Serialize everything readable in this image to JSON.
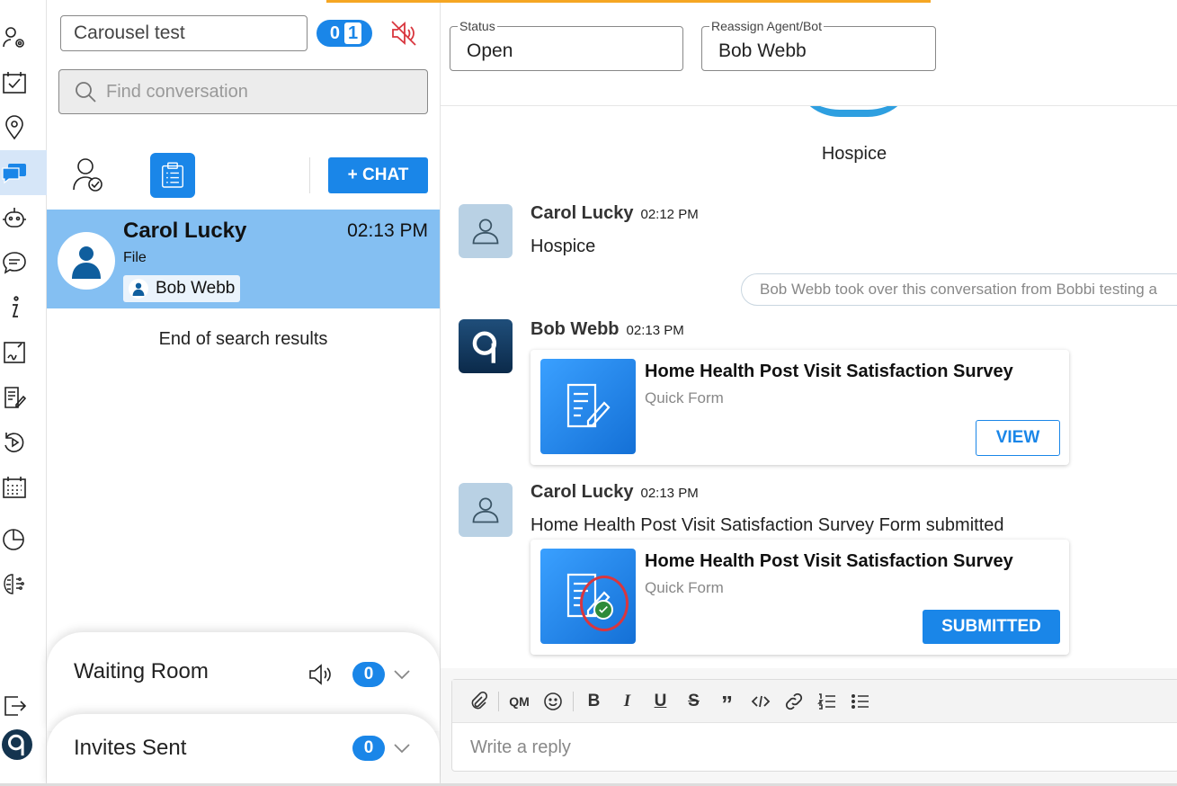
{
  "sidebar": {
    "items": [
      {
        "icon": "user-settings-icon"
      },
      {
        "icon": "calendar-check-icon"
      },
      {
        "icon": "location-pin-icon"
      },
      {
        "icon": "chat-icon",
        "active": true
      },
      {
        "icon": "bot-icon"
      },
      {
        "icon": "message-bubble-icon"
      },
      {
        "icon": "info-icon"
      },
      {
        "icon": "form-signature-icon"
      },
      {
        "icon": "document-edit-icon"
      },
      {
        "icon": "history-play-icon"
      },
      {
        "icon": "calendar-grid-icon"
      },
      {
        "icon": "pie-chart-icon"
      },
      {
        "icon": "brain-icon"
      },
      {
        "icon": "logout-icon"
      },
      {
        "icon": "app-logo-icon"
      }
    ]
  },
  "list": {
    "conversation_name": "Carousel test",
    "toggle": {
      "left": "0",
      "right": "1"
    },
    "search_placeholder": "Find conversation",
    "chat_button": "+ CHAT",
    "conversation": {
      "name": "Carol Lucky",
      "time": "02:13 PM",
      "subtitle": "File",
      "agent": "Bob Webb"
    },
    "end_text": "End of search results",
    "waiting_room": {
      "title": "Waiting Room",
      "count": "0"
    },
    "invites_sent": {
      "title": "Invites Sent",
      "count": "0"
    }
  },
  "header": {
    "status_label": "Status",
    "status_value": "Open",
    "agent_label": "Reassign Agent/Bot",
    "agent_value": "Bob Webb"
  },
  "messages": {
    "prev_label": "Hospice",
    "m1": {
      "name": "Carol Lucky",
      "time": "02:12 PM",
      "text": "Hospice"
    },
    "system": "Bob Webb took over this conversation from Bobbi testing a",
    "m2": {
      "name": "Bob Webb",
      "time": "02:13 PM",
      "card": {
        "title": "Home Health Post Visit Satisfaction Survey",
        "sub": "Quick Form",
        "button": "VIEW"
      }
    },
    "m3": {
      "name": "Carol Lucky",
      "time": "02:13 PM",
      "text": "Home Health Post Visit Satisfaction Survey Form submitted",
      "card": {
        "title": "Home Health Post Visit Satisfaction Survey",
        "sub": "Quick Form",
        "button": "SUBMITTED"
      }
    }
  },
  "composer": {
    "toolbar": {
      "qm": "QM",
      "bold": "B",
      "italic": "I",
      "underline": "U",
      "strike": "S",
      "quote": "”"
    },
    "placeholder": "Write a reply"
  },
  "colors": {
    "accent": "#1a86e8",
    "selected_row": "#84bff2",
    "alert": "#d9363e",
    "top_bar": "#f5a623"
  }
}
